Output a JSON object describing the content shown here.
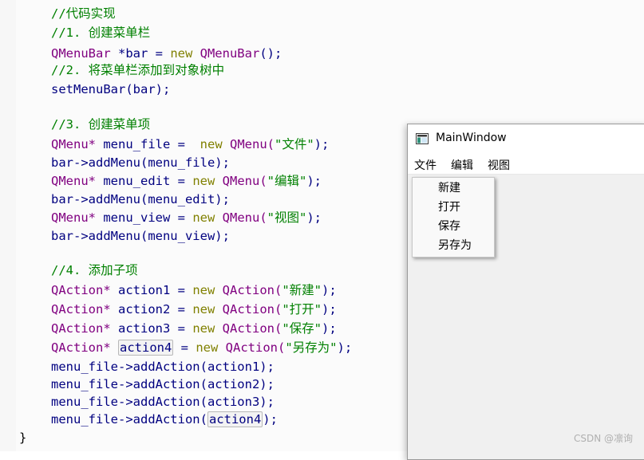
{
  "code": {
    "comment_impl": "//代码实现",
    "comment_1": "//1. 创建菜单栏",
    "line_menubar": {
      "type": "QMenuBar",
      "mid": " *bar = ",
      "kw": "new",
      "ctor": " QMenuBar",
      "tail": "();"
    },
    "comment_2": "//2. 将菜单栏添加到对象树中",
    "line_setmenubar": "setMenuBar(bar);",
    "comment_3": "//3. 创建菜单项",
    "menus": [
      {
        "type": "QMenu*",
        "var": " menu_file = ",
        "pad": " ",
        "kw": "new",
        "ctor": " QMenu(",
        "str": "\"文件\"",
        "tail": ");",
        "add": "bar->addMenu(menu_file);"
      },
      {
        "type": "QMenu*",
        "var": " menu_edit = ",
        "pad": "",
        "kw": "new",
        "ctor": " QMenu(",
        "str": "\"编辑\"",
        "tail": ");",
        "add": "bar->addMenu(menu_edit);"
      },
      {
        "type": "QMenu*",
        "var": " menu_view = ",
        "pad": "",
        "kw": "new",
        "ctor": " QMenu(",
        "str": "\"视图\"",
        "tail": ");",
        "add": "bar->addMenu(menu_view);"
      }
    ],
    "comment_4": "//4. 添加子项",
    "actions": [
      {
        "type": "QAction*",
        "var": "action1",
        "eq": " = ",
        "kw": "new",
        "ctor": " QAction(",
        "str": "\"新建\"",
        "tail": ");"
      },
      {
        "type": "QAction*",
        "var": "action2",
        "eq": " = ",
        "kw": "new",
        "ctor": " QAction(",
        "str": "\"打开\"",
        "tail": ");"
      },
      {
        "type": "QAction*",
        "var": "action3",
        "eq": " = ",
        "kw": "new",
        "ctor": " QAction(",
        "str": "\"保存\"",
        "tail": ");"
      },
      {
        "type": "QAction*",
        "var": "action4",
        "eq": " = ",
        "kw": "new",
        "ctor": " QAction(",
        "str": "\"另存为\"",
        "tail": ");"
      }
    ],
    "add_actions": [
      {
        "pre": "menu_file->addAction(",
        "arg": "action1",
        "tail": ");"
      },
      {
        "pre": "menu_file->addAction(",
        "arg": "action2",
        "tail": ");"
      },
      {
        "pre": "menu_file->addAction(",
        "arg": "action3",
        "tail": ");"
      },
      {
        "pre": "menu_file->addAction(",
        "arg": "action4",
        "tail": ");"
      }
    ],
    "closing_brace": "}"
  },
  "window": {
    "title": "MainWindow",
    "menubar": [
      "文件",
      "编辑",
      "视图"
    ],
    "file_menu_items": [
      "新建",
      "打开",
      "保存",
      "另存为"
    ]
  },
  "watermark": "CSDN @凛询",
  "colors": {
    "comment": "#008000",
    "type": "#800080",
    "keyword": "#808000",
    "string": "#008000",
    "identifier": "#000080"
  }
}
